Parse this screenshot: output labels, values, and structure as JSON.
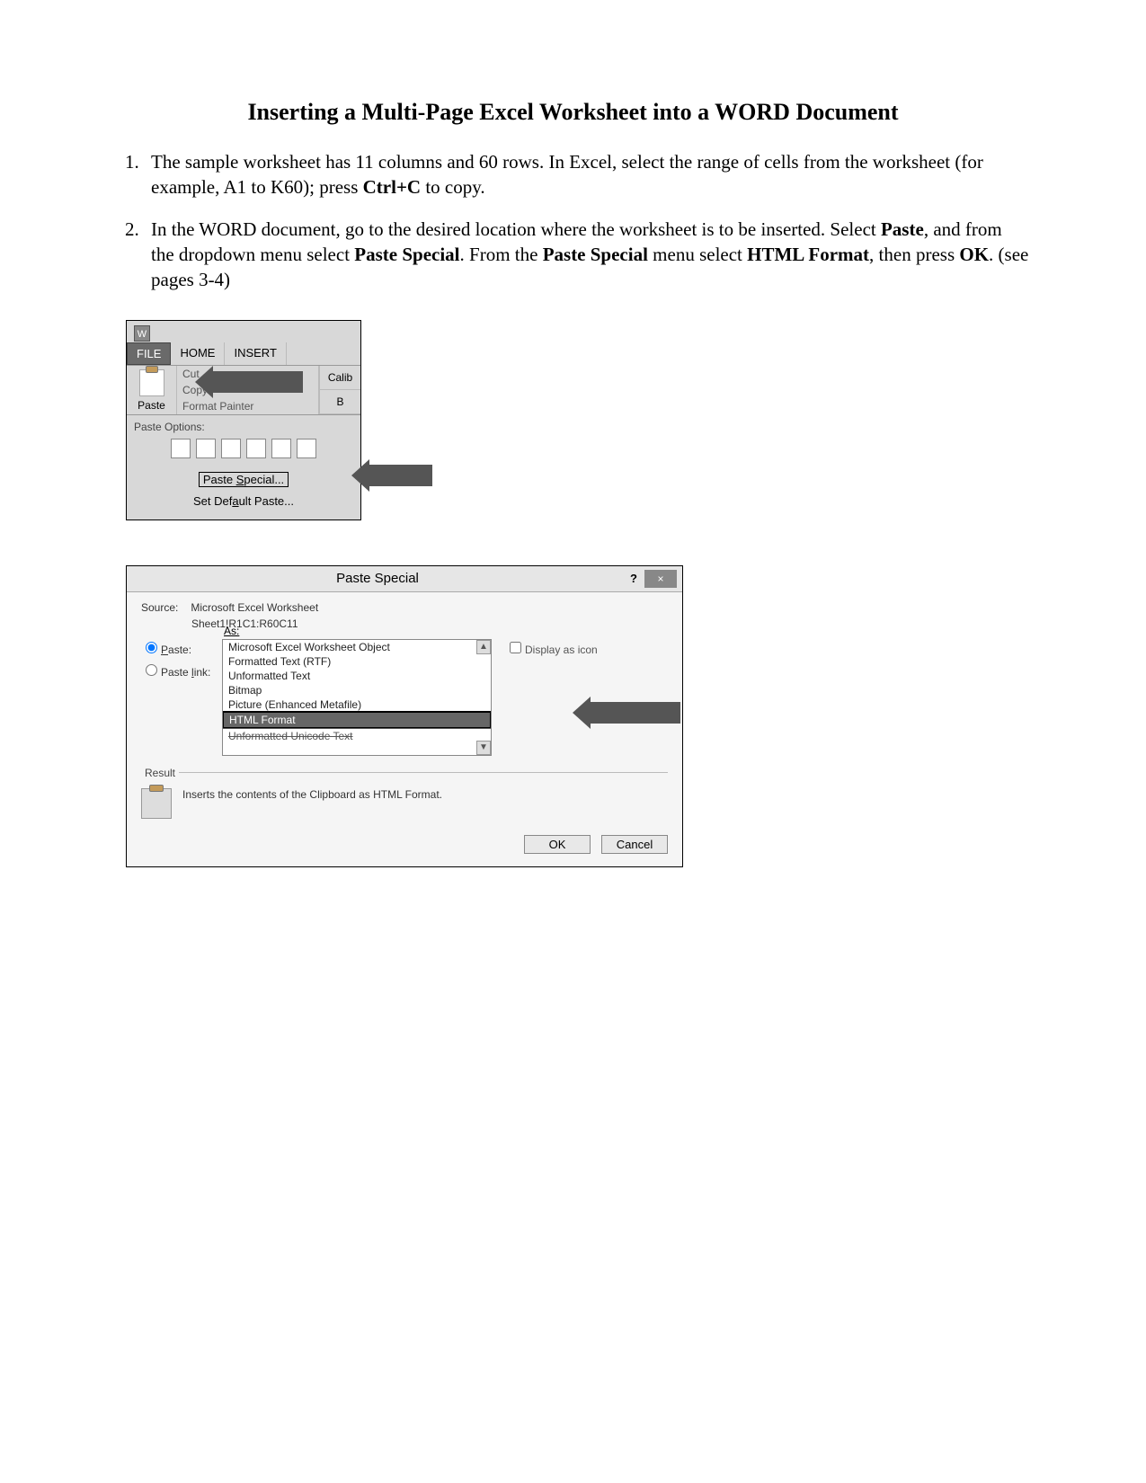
{
  "title": "Inserting a Multi-Page Excel Worksheet into a WORD Document",
  "instr": {
    "i1a": "The sample worksheet has 11 columns and 60 rows. In Excel, select the range of cells from the worksheet (for example, A1 to K60); press ",
    "ctrlc": "Ctrl+C",
    "i1b": " to copy.",
    "i2a": "In the WORD document, go to the desired location where the worksheet is to be inserted. Select ",
    "paste": "Paste",
    "i2b": ", and from the dropdown menu select ",
    "pspecial": "Paste Special",
    "i2c": ". From the ",
    "i2d": " menu select ",
    "htmlfmt": "HTML Format",
    "i2e": ", then press ",
    "ok": "OK",
    "i2f": ". (see pages 3-4)"
  },
  "ribbon": {
    "tab_file": "FILE",
    "tab_home": "HOME",
    "tab_insert": "INSERT",
    "paste": "Paste",
    "cut": "Cut",
    "copy": "Copy",
    "format_painter": "Format Painter",
    "calib": "Calib",
    "b": "B",
    "paste_options": "Paste Options:",
    "paste_special": "Paste Special...",
    "set_default": "Set Default Paste..."
  },
  "dialog": {
    "title": "Paste Special",
    "source_label": "Source:",
    "source_val1": "Microsoft Excel Worksheet",
    "source_val2": "Sheet1!R1C1:R60C11",
    "as_label": "As:",
    "paste_radio": "Paste:",
    "paste_link_radio": "Paste link:",
    "opts": [
      "Microsoft Excel Worksheet Object",
      "Formatted Text (RTF)",
      "Unformatted Text",
      "Bitmap",
      "Picture (Enhanced Metafile)",
      "HTML Format",
      "Unformatted Unicode Text"
    ],
    "display_as_icon": "Display as icon",
    "result_heading": "Result",
    "result_text": "Inserts the contents of the Clipboard as HTML Format.",
    "ok": "OK",
    "cancel": "Cancel"
  }
}
